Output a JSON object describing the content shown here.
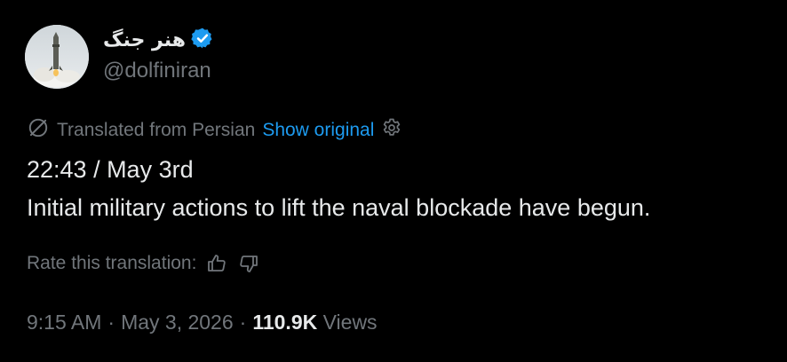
{
  "author": {
    "display_name": "هنر جنگ",
    "handle": "@dolfiniran",
    "verified": true,
    "verified_color": "#1d9bf0"
  },
  "translation": {
    "label": "Translated from Persian",
    "show_original": "Show original",
    "rate_label": "Rate this translation:"
  },
  "tweet": {
    "lines": [
      "22:43 / May 3rd",
      "Initial military actions to lift the naval blockade have begun."
    ]
  },
  "meta": {
    "time": "9:15 AM",
    "separator": "·",
    "date": "May 3, 2026",
    "views_count": "110.9K",
    "views_label": "Views"
  },
  "colors": {
    "background": "#000000",
    "text": "#e7e9ea",
    "secondary": "#71767b",
    "link": "#1d9bf0"
  },
  "icons": [
    "translate-icon",
    "settings-gear-icon",
    "thumbs-up-icon",
    "thumbs-down-icon",
    "verified-badge-icon"
  ]
}
